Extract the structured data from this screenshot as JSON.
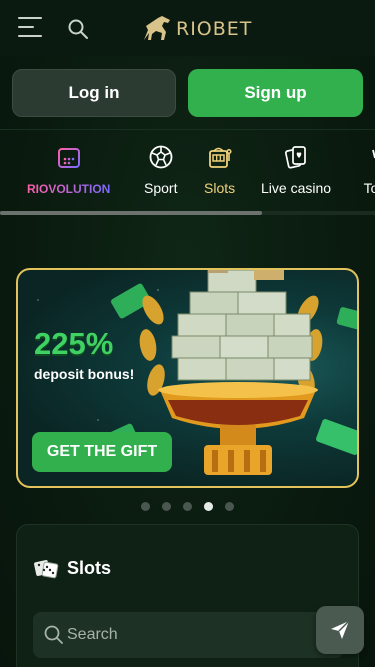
{
  "header": {
    "logo_text": "RIOBET",
    "menu_icon": "hamburger-menu-icon",
    "search_icon": "search-icon"
  },
  "auth": {
    "login_label": "Log in",
    "signup_label": "Sign up"
  },
  "categories": [
    {
      "label": "RIOVOLUTION",
      "icon": "calendar-icon"
    },
    {
      "label": "Sport",
      "icon": "soccer-ball-icon"
    },
    {
      "label": "Slots",
      "icon": "slot-machine-icon",
      "active": true
    },
    {
      "label": "Live casino",
      "icon": "live-cards-icon"
    },
    {
      "label": "To",
      "icon": "trophy-icon"
    }
  ],
  "banner": {
    "percent": "225%",
    "subtitle": "deposit bonus!",
    "cta": "GET THE GIFT",
    "active_slide": 4,
    "slide_count": 5
  },
  "slots": {
    "title": "Slots",
    "icon": "dice-icon",
    "search_placeholder": "Search"
  },
  "fab": {
    "icon": "paper-plane-icon"
  },
  "colors": {
    "accent_green": "#33b04e",
    "gold": "#e3c35b",
    "active_tab": "#f0d27a"
  }
}
